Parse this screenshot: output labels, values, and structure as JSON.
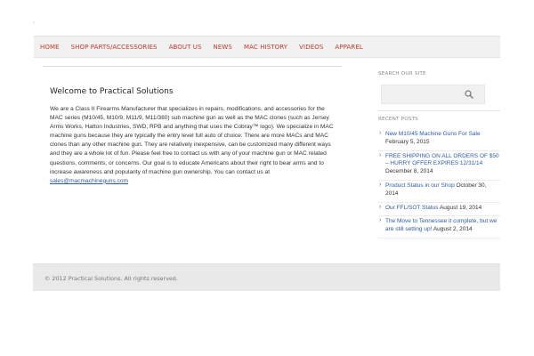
{
  "header": {
    "mark": "°"
  },
  "nav": {
    "items": [
      "HOME",
      "SHOP PARTS/ACCESSORIES",
      "ABOUT US",
      "NEWS",
      "MAC HISTORY",
      "VIDEOS",
      "APPAREL"
    ]
  },
  "main": {
    "title": "Welcome to Practical Solutions",
    "body": "We are a Class II Firearms Manufacturer that specializes in repairs, modifications, and accessories for the MAC series (M10/45, M10/9, M11/9, M11/380) sub machine gun as well as the MAC clones (such as Jersey Arms Works, Hatton Industries, SWD, RPB and anything that uses the Cobray™ logo). We specialize in MAC machine guns because they are typically the entry level full auto of choice. There are more MACs and MAC clones than any other machine gun. They are relatively inexpensive, can be customized many different ways and they are a whole lot of fun. Please feel free to contact us with any of your machine gun or MAC related questions, comments, or concerns. Our goal is to educate Americans about their right to bear arms and to increase awareness and popularity of machine gun ownership. You can contact us at ",
    "email": "sales@macmachineguns.com"
  },
  "sidebar": {
    "search_title": "SEARCH OUR SITE",
    "search_value": "",
    "recent_title": "RECENT POSTS",
    "posts": [
      {
        "title": "New M10/45 Machine Guns For Sale",
        "date": "February 5, 2015"
      },
      {
        "title": "FREE SHIPPING ON ALL ORDERS OF $50 – HURRY OFFER EXPIRES 12/31/14",
        "date": "December 8, 2014"
      },
      {
        "title": "Product Status in our Shop",
        "date": "October 30, 2014"
      },
      {
        "title": "Our FFL/SOT Status",
        "date": "August 19, 2014"
      },
      {
        "title": "The Move to Tennessee it complete, but we are still setting up!",
        "date": "August 2, 2014"
      }
    ]
  },
  "footer": {
    "copyright": "© 2012 Practical Solutions. All rights reserved."
  },
  "colors": {
    "nav_link": "#c0392b",
    "link": "#2e5aa8",
    "footer_bg": "#e9e9e9"
  }
}
